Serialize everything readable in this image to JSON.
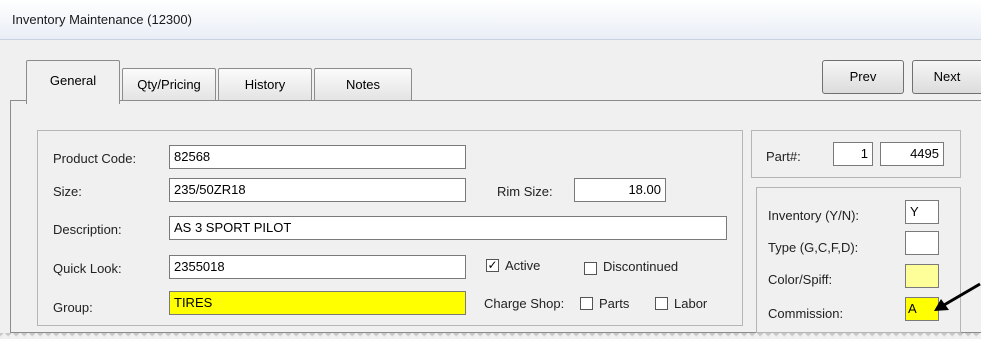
{
  "window": {
    "title": "Inventory Maintenance (12300)"
  },
  "tabs": [
    {
      "label": "General",
      "active": true
    },
    {
      "label": "Qty/Pricing",
      "active": false
    },
    {
      "label": "History",
      "active": false
    },
    {
      "label": "Notes",
      "active": false
    }
  ],
  "nav": {
    "prev_label": "Prev",
    "next_label": "Next"
  },
  "form": {
    "product_code_label": "Product Code:",
    "product_code_value": "82568",
    "size_label": "Size:",
    "size_value": "235/50ZR18",
    "rim_size_label": "Rim Size:",
    "rim_size_value": "18.00",
    "description_label": "Description:",
    "description_value": "AS 3 SPORT PILOT",
    "quick_look_label": "Quick Look:",
    "quick_look_value": "2355018",
    "active_label": "Active",
    "active_checked": true,
    "discontinued_label": "Discontinued",
    "discontinued_checked": false,
    "group_label": "Group:",
    "group_value": "TIRES",
    "charge_shop_label": "Charge Shop:",
    "parts_label": "Parts",
    "parts_checked": false,
    "labor_label": "Labor",
    "labor_checked": false
  },
  "part": {
    "label": "Part#:",
    "prefix_value": "1",
    "number_value": "4495"
  },
  "flags": {
    "inventory_label": "Inventory (Y/N):",
    "inventory_value": "Y",
    "type_label": "Type (G,C,F,D):",
    "type_value": "",
    "color_spiff_label": "Color/Spiff:",
    "color_spiff_value": "",
    "commission_label": "Commission:",
    "commission_value": "A"
  },
  "colors": {
    "highlight_yellow": "#ffff00",
    "light_yellow": "#ffff99",
    "arrow": "#000000"
  },
  "annotations": {
    "arrow_target": "commission-field"
  }
}
